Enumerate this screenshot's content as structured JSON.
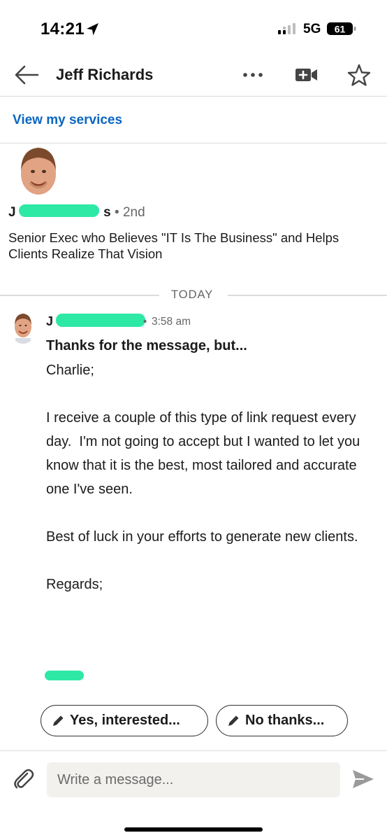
{
  "status_bar": {
    "time": "14:21",
    "network": "5G",
    "battery": "61"
  },
  "header": {
    "title": "Jeff Richards",
    "icons": [
      "back-arrow-icon",
      "more-icon",
      "video-call-icon",
      "star-icon"
    ]
  },
  "services": {
    "link_label": "View my services"
  },
  "profile": {
    "name_start": "J",
    "name_end": "s",
    "separator": " • ",
    "degree": "2nd",
    "headline": "Senior Exec who Believes \"IT Is The Business\" and Helps Clients Realize That Vision"
  },
  "divider": {
    "label": "TODAY"
  },
  "message": {
    "sender_visible": "J",
    "separator": "•",
    "time": "3:58 am",
    "subject": "Thanks for the message, but...",
    "body": "Charlie;\n\nI receive a couple of this type of link request every day.  I'm not going to accept but I wanted to let you know that it is the best, most tailored and accurate one I've seen.\n\nBest of luck in your efforts to generate new clients.\n\nRegards;"
  },
  "quick_replies": [
    {
      "label": "Yes, interested..."
    },
    {
      "label": "No thanks..."
    }
  ],
  "composer": {
    "placeholder": "Write a message..."
  },
  "colors": {
    "link_blue": "#0a66c2",
    "redaction_green": "#2ee8a6",
    "divider_gray": "#dcdcdc",
    "input_bg": "#f2f1ee"
  }
}
